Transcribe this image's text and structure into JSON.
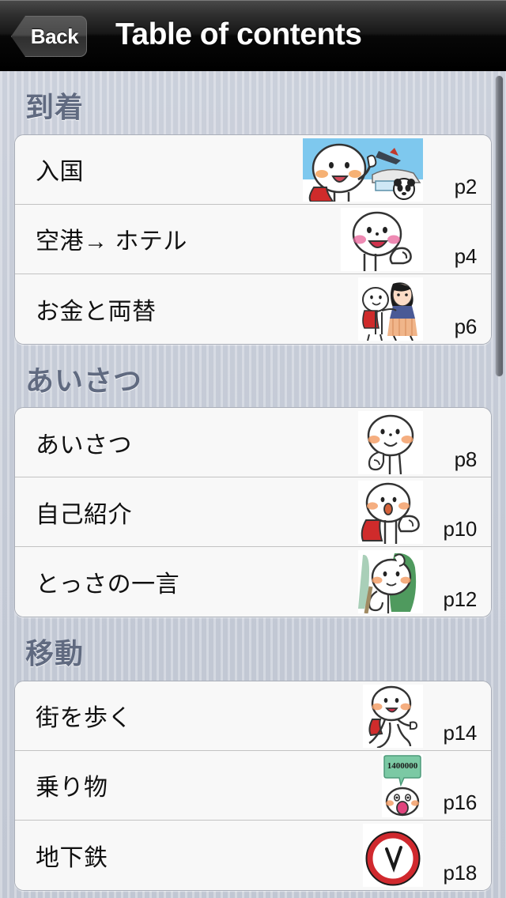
{
  "navbar": {
    "back_label": "Back",
    "title": "Table of contents"
  },
  "sections": [
    {
      "title": "到着",
      "items": [
        {
          "label": "入国",
          "page": "p2",
          "thumb": "arrival-airport-panda-thumb"
        },
        {
          "label": "空港→ ホテル",
          "page": "p4",
          "thumb": "character-thumbs-up-thumb"
        },
        {
          "label": "お金と両替",
          "page": "p6",
          "thumb": "character-with-girl-thumb"
        }
      ]
    },
    {
      "title": "あいさつ",
      "items": [
        {
          "label": "あいさつ",
          "page": "p8",
          "thumb": "character-waving-greeting-thumb"
        },
        {
          "label": "自己紹介",
          "page": "p10",
          "thumb": "character-red-scarf-talking-thumb"
        },
        {
          "label": "とっさの一言",
          "page": "p12",
          "thumb": "character-green-background-thumb"
        }
      ]
    },
    {
      "title": "移動",
      "items": [
        {
          "label": "街を歩く",
          "page": "p14",
          "thumb": "character-walking-thumb"
        },
        {
          "label": "乗り物",
          "page": "p16",
          "thumb": "speech-bubble-price-shocked-thumb"
        },
        {
          "label": "地下鉄",
          "page": "p18",
          "thumb": "red-circle-subway-sign-thumb"
        }
      ]
    }
  ],
  "colors": {
    "navbar_background": "#000000",
    "page_background": "#c6cbd6",
    "section_title": "#606a80",
    "row_background": "#f8f8f8",
    "row_text": "#111111",
    "scrollbar": "#6e727a"
  },
  "scrollbar": {
    "visible": true
  }
}
